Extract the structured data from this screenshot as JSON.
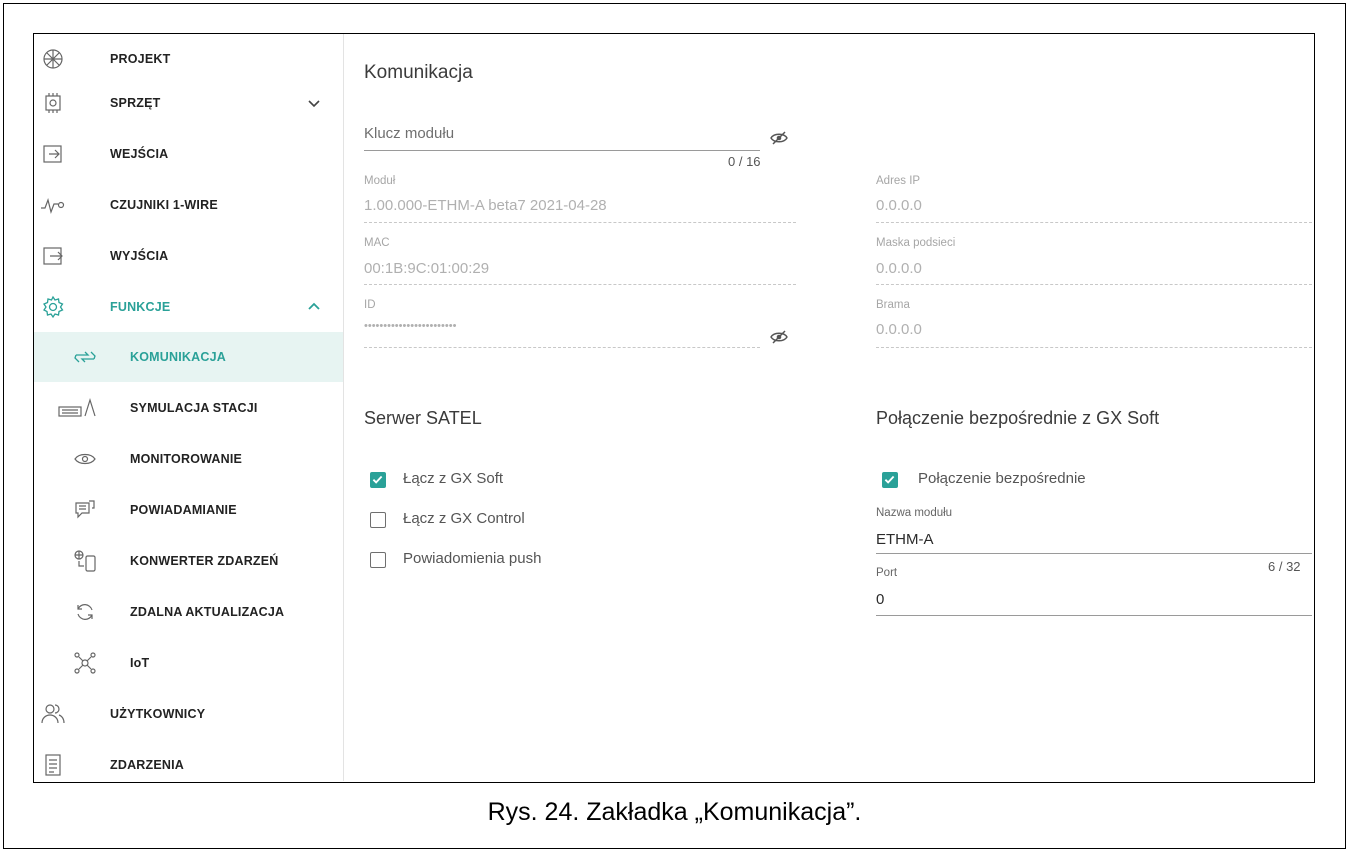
{
  "sidebar": {
    "items": [
      {
        "label": "PROJEKT",
        "icon": "project-icon"
      },
      {
        "label": "SPRZĘT",
        "icon": "hardware-chip-icon",
        "expandable": true,
        "expanded": false
      },
      {
        "label": "WEJŚCIA",
        "icon": "input-arrow-icon"
      },
      {
        "label": "CZUJNIKI 1-WIRE",
        "icon": "sensor-wave-icon"
      },
      {
        "label": "WYJŚCIA",
        "icon": "output-arrow-icon"
      },
      {
        "label": "FUNKCJE",
        "icon": "gear-icon",
        "expandable": true,
        "expanded": true
      },
      {
        "label": "KOMUNIKACJA",
        "icon": "communication-arrows-icon",
        "selected": true
      },
      {
        "label": "SYMULACJA STACJI",
        "icon": "station-simulation-icon"
      },
      {
        "label": "MONITOROWANIE",
        "icon": "eye-icon"
      },
      {
        "label": "POWIADAMIANIE",
        "icon": "chat-bubble-icon"
      },
      {
        "label": "KONWERTER ZDARZEŃ",
        "icon": "event-converter-icon"
      },
      {
        "label": "ZDALNA AKTUALIZACJA",
        "icon": "refresh-icon"
      },
      {
        "label": "IoT",
        "icon": "iot-network-icon"
      },
      {
        "label": "UŻYTKOWNICY",
        "icon": "users-icon"
      },
      {
        "label": "ZDARZENIA",
        "icon": "document-list-icon"
      }
    ]
  },
  "main": {
    "title": "Komunikacja",
    "module_key": {
      "placeholder": "Klucz modułu",
      "value": "",
      "counter": "0 / 16"
    },
    "left_fields": [
      {
        "label": "Moduł",
        "value": "1.00.000-ETHM-A  beta7 2021-04-28"
      },
      {
        "label": "MAC",
        "value": "00:1B:9C:01:00:29"
      },
      {
        "label": "ID",
        "value": "••••••••••••••••••••••••"
      }
    ],
    "right_fields": [
      {
        "label": "Adres IP",
        "value": "0.0.0.0"
      },
      {
        "label": "Maska podsieci",
        "value": "0.0.0.0"
      },
      {
        "label": "Brama",
        "value": "0.0.0.0"
      }
    ],
    "satel_server": {
      "title": "Serwer SATEL",
      "options": [
        {
          "label": "Łącz z GX Soft",
          "checked": true
        },
        {
          "label": "Łącz z GX Control",
          "checked": false
        },
        {
          "label": "Powiadomienia push",
          "checked": false
        }
      ]
    },
    "direct": {
      "title": "Połączenie bezpośrednie z GX Soft",
      "checkbox": {
        "label": "Połączenie bezpośrednie",
        "checked": true
      },
      "module_name": {
        "label": "Nazwa modułu",
        "value": "ETHM-A",
        "counter": "6 / 32"
      },
      "port": {
        "label": "Port",
        "value": "0"
      }
    }
  },
  "caption": "Rys. 24. Zakładka „Komunikacja”.",
  "colors": {
    "accent": "#2aa198",
    "selected_bg": "#e7f4f2"
  }
}
